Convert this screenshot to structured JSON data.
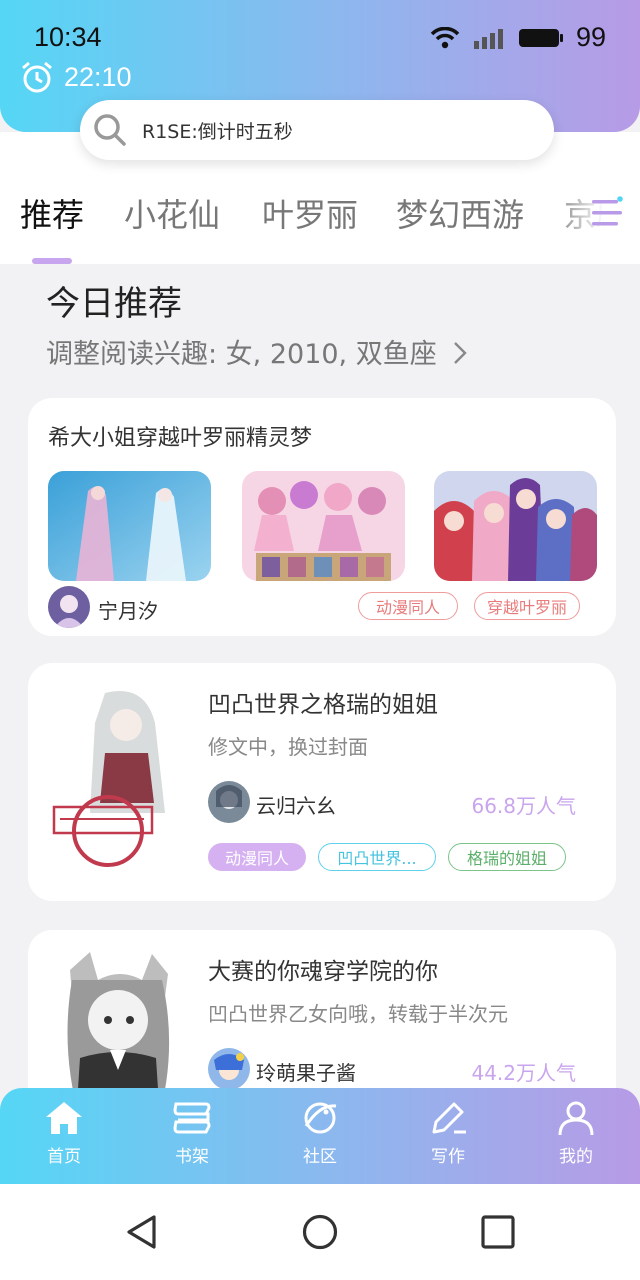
{
  "status": {
    "time": "10:34",
    "battery": "99",
    "alarm_time": "22:10"
  },
  "search": {
    "placeholder": "R1SE:倒计时五秒"
  },
  "tabs": [
    {
      "label": "推荐"
    },
    {
      "label": "小花仙"
    },
    {
      "label": "叶罗丽"
    },
    {
      "label": "梦幻西游"
    },
    {
      "label": "京剧"
    }
  ],
  "section": {
    "title": "今日推荐",
    "subtitle": "调整阅读兴趣: 女, 2010, 双鱼座"
  },
  "feature_card": {
    "title": "希大小姐穿越叶罗丽精灵梦",
    "author": "宁月汐",
    "tags": [
      "动漫同人",
      "穿越叶罗丽"
    ]
  },
  "books": [
    {
      "title": "凹凸世界之格瑞的姐姐",
      "desc": "修文中，换过封面",
      "author": "云归六幺",
      "popularity": "66.8万人气",
      "tags": [
        "动漫同人",
        "凹凸世界...",
        "格瑞的姐姐"
      ]
    },
    {
      "title": "大赛的你魂穿学院的你",
      "desc": "凹凸世界乙女向哦，转载于半次元",
      "author": "玲萌果子酱",
      "popularity": "44.2万人气"
    }
  ],
  "nav": [
    {
      "label": "首页",
      "icon": "home-icon"
    },
    {
      "label": "书架",
      "icon": "bookshelf-icon"
    },
    {
      "label": "社区",
      "icon": "planet-icon"
    },
    {
      "label": "写作",
      "icon": "pen-icon"
    },
    {
      "label": "我的",
      "icon": "person-icon"
    }
  ],
  "colors": {
    "accent": "#c9a5ee",
    "gradient_start": "#55d6f5",
    "gradient_end": "#b79be6"
  }
}
